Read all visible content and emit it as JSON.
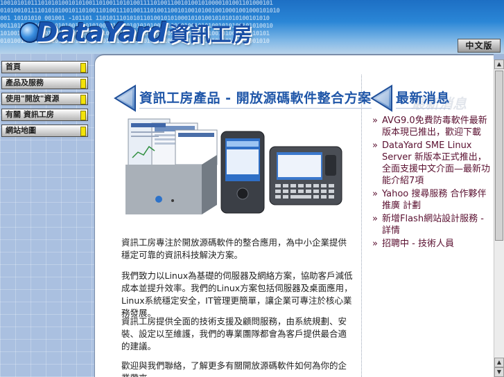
{
  "header": {
    "binary_pattern": "10010101011101010100101010011010011010100111101001100101001010000101001101000101\n0101001011110101010010110100110100111010011101001100101001010010010001001000101010\n001 10101010 001001 -101101 110101110101011010010101000101010010101010100101010\n00110100101010010101001010101001010100101010100101001010010101001010100101010010\n1010010101001010100101010010101001010100101001010010101001010100101001010010101\n0101001010100101010010101001010100101010010100101001010100101010010100101001010",
    "logo_text": "DataYard",
    "logo_cn": "資訊工房",
    "lang_button": "中文版"
  },
  "nav": {
    "items": [
      {
        "label": "首頁"
      },
      {
        "label": "產品及服務"
      },
      {
        "label": "使用\"開放\"資源"
      },
      {
        "label": "有關 資訊工房"
      },
      {
        "label": "網站地圖"
      }
    ]
  },
  "main": {
    "title": "資訊工房產品 - 開放源碼軟件整合方案",
    "paragraphs": [
      "資訊工房專注於開放源碼軟件的整合應用，為中小企業提供穩定可靠的資訊科技解決方案。",
      "我們致力以Linux為基礎的伺服器及網絡方案，協助客戶減低成本並提升效率。我們的Linux方案包括伺服器及桌面應用，Linux系統穩定安全，IT管理更簡單，讓企業可專注於核心業務發展。",
      "資訊工房提供全面的技術支援及顧問服務，由系統規劃、安裝、設定以至維護，我們的專業團隊都會為客戶提供最合適的建議。",
      "歡迎與我們聯絡，了解更多有關開放源碼軟件如何為你的企業帶來"
    ]
  },
  "side": {
    "title": "最新消息",
    "ghost": "最新消息",
    "news": [
      {
        "text": "AVG9.0免費防毒軟件最新版本現已推出，歡迎下載"
      },
      {
        "text": "DataYard SME Linux Server 新版本正式推出，全面支援中文介面—最新功能介紹7項"
      },
      {
        "text": "Yahoo 搜尋服務 合作夥伴推廣 計劃"
      },
      {
        "text": "新增Flash網站設計服務 - 詳情"
      },
      {
        "text": "招聘中 - 技術人員"
      }
    ]
  },
  "colors": {
    "link": "#1f56a8",
    "news": "#5a1030",
    "nav_accent": "#f3e30a"
  }
}
